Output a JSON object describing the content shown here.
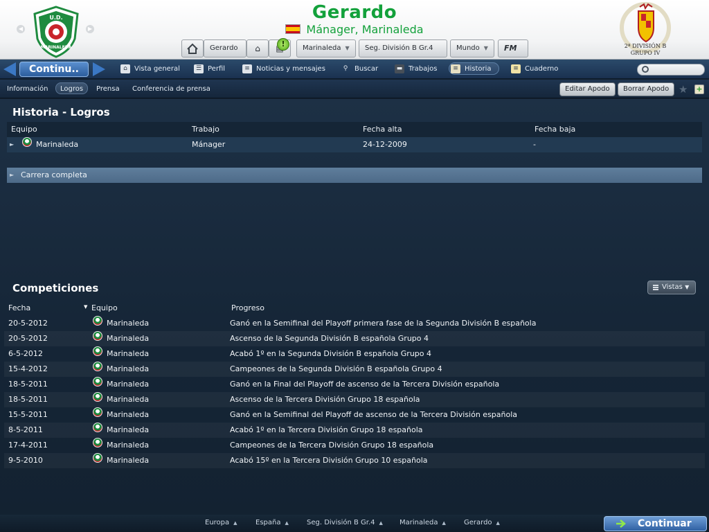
{
  "header": {
    "manager_name": "Gerardo",
    "manager_role": "Mánager, Marinaleda",
    "club_crest_lettering": [
      "U.D.",
      "MARINALEDA"
    ],
    "competition_crest_lettering": [
      "2ª DIVISIÓN B",
      "GRUPO IV"
    ],
    "buttons": {
      "home": "home-icon",
      "manager_menu": "Gerardo",
      "club_menu": "Marinaleda",
      "competition_menu": "Seg. División B Gr.4",
      "world_menu": "Mundo",
      "fm_menu": "FM"
    },
    "warning_badge": "!"
  },
  "navbar": {
    "continue_label": "Continu..",
    "items": [
      {
        "label": "Vista general",
        "icon": "house-icon"
      },
      {
        "label": "Perfil",
        "icon": "profile-card-icon"
      },
      {
        "label": "Noticias y mensajes",
        "icon": "news-icon"
      },
      {
        "label": "Buscar",
        "icon": "search-icon"
      },
      {
        "label": "Trabajos",
        "icon": "briefcase-icon"
      },
      {
        "label": "Historia",
        "icon": "scroll-icon"
      },
      {
        "label": "Cuaderno",
        "icon": "notebook-icon"
      }
    ],
    "active_item": "Historia",
    "search_value": ""
  },
  "subnav": {
    "tabs": [
      "Información",
      "Logros",
      "Prensa",
      "Conferencia de prensa"
    ],
    "active_tab": "Logros",
    "edit_nickname": "Editar Apodo",
    "delete_nickname": "Borrar Apodo"
  },
  "history": {
    "title": "Historia - Logros",
    "columns": [
      "Equipo",
      "Trabajo",
      "Fecha alta",
      "Fecha baja"
    ],
    "rows": [
      {
        "team": "Marinaleda",
        "job": "Mánager",
        "start": "24-12-2009",
        "end": "-"
      }
    ],
    "career_label": "Carrera completa"
  },
  "competitions": {
    "title": "Competiciones",
    "views_label": "Vistas",
    "columns": [
      "Fecha",
      "Equipo",
      "Progreso"
    ],
    "rows": [
      {
        "date": "20-5-2012",
        "team": "Marinaleda",
        "progress": "Ganó en la Semifinal del Playoff primera fase de la Segunda División B española"
      },
      {
        "date": "20-5-2012",
        "team": "Marinaleda",
        "progress": "Ascenso de la Segunda División B española Grupo 4"
      },
      {
        "date": "6-5-2012",
        "team": "Marinaleda",
        "progress": "Acabó 1º en la Segunda División B española Grupo 4"
      },
      {
        "date": "15-4-2012",
        "team": "Marinaleda",
        "progress": "Campeones de la Segunda División B española Grupo 4"
      },
      {
        "date": "18-5-2011",
        "team": "Marinaleda",
        "progress": "Ganó en la Final del Playoff de ascenso de la Tercera División española"
      },
      {
        "date": "18-5-2011",
        "team": "Marinaleda",
        "progress": "Ascenso de la Tercera División Grupo 18 española"
      },
      {
        "date": "15-5-2011",
        "team": "Marinaleda",
        "progress": "Ganó en la Semifinal del Playoff de ascenso de la Tercera División española"
      },
      {
        "date": "8-5-2011",
        "team": "Marinaleda",
        "progress": "Acabó 1º en la Tercera División Grupo 18 española"
      },
      {
        "date": "17-4-2011",
        "team": "Marinaleda",
        "progress": "Campeones de la Tercera División Grupo 18 española"
      },
      {
        "date": "9-5-2010",
        "team": "Marinaleda",
        "progress": "Acabó 15º en la Tercera División Grupo 10 española"
      }
    ]
  },
  "footer": {
    "breadcrumbs": [
      "Europa",
      "España",
      "Seg. División B Gr.4",
      "Marinaleda",
      "Gerardo"
    ],
    "continue_label": "Continuar"
  },
  "colors": {
    "accent_green": "#13a13b",
    "nav_blue": "#1a3150",
    "panel_bg": "#152536",
    "continue_blue": "#2f60a2"
  }
}
